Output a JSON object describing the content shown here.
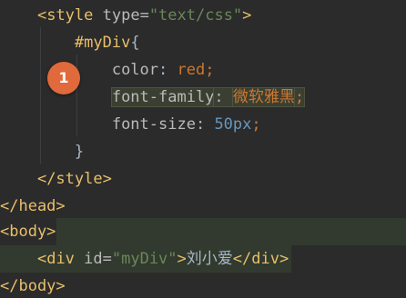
{
  "code": {
    "line1": {
      "open": "<",
      "tag": "style",
      "attr": " type=",
      "str": "\"text/css\"",
      "close": ">"
    },
    "line2": {
      "selector": "#myDiv",
      "brace": "{"
    },
    "line3": {
      "prop": "color",
      "colon": ": ",
      "value": "red",
      "semi": ";"
    },
    "line4": {
      "prop": "font-family",
      "colon": ": ",
      "value": "微软雅黑",
      "semi": ";"
    },
    "line5": {
      "prop": "font-size",
      "colon": ": ",
      "value": "50px",
      "semi": ";"
    },
    "line6": {
      "brace": "}"
    },
    "line7": {
      "tag": "</style>"
    },
    "line8": {
      "tag": "</head>"
    },
    "line9": {
      "tag": "<body>"
    },
    "line10": {
      "open": "<",
      "tag": "div",
      "attr": " id=",
      "str": "\"myDiv\"",
      "close": ">",
      "text": "刘小爱",
      "end": "</div>"
    },
    "line11": {
      "tag": "</body>"
    }
  },
  "badge": {
    "label": "1"
  },
  "colors": {
    "background": "#2b2b2b",
    "tag": "#e8bf6a",
    "string": "#6a8759",
    "number": "#6897bb",
    "value": "#cc7832",
    "badge": "#e06a3b"
  }
}
